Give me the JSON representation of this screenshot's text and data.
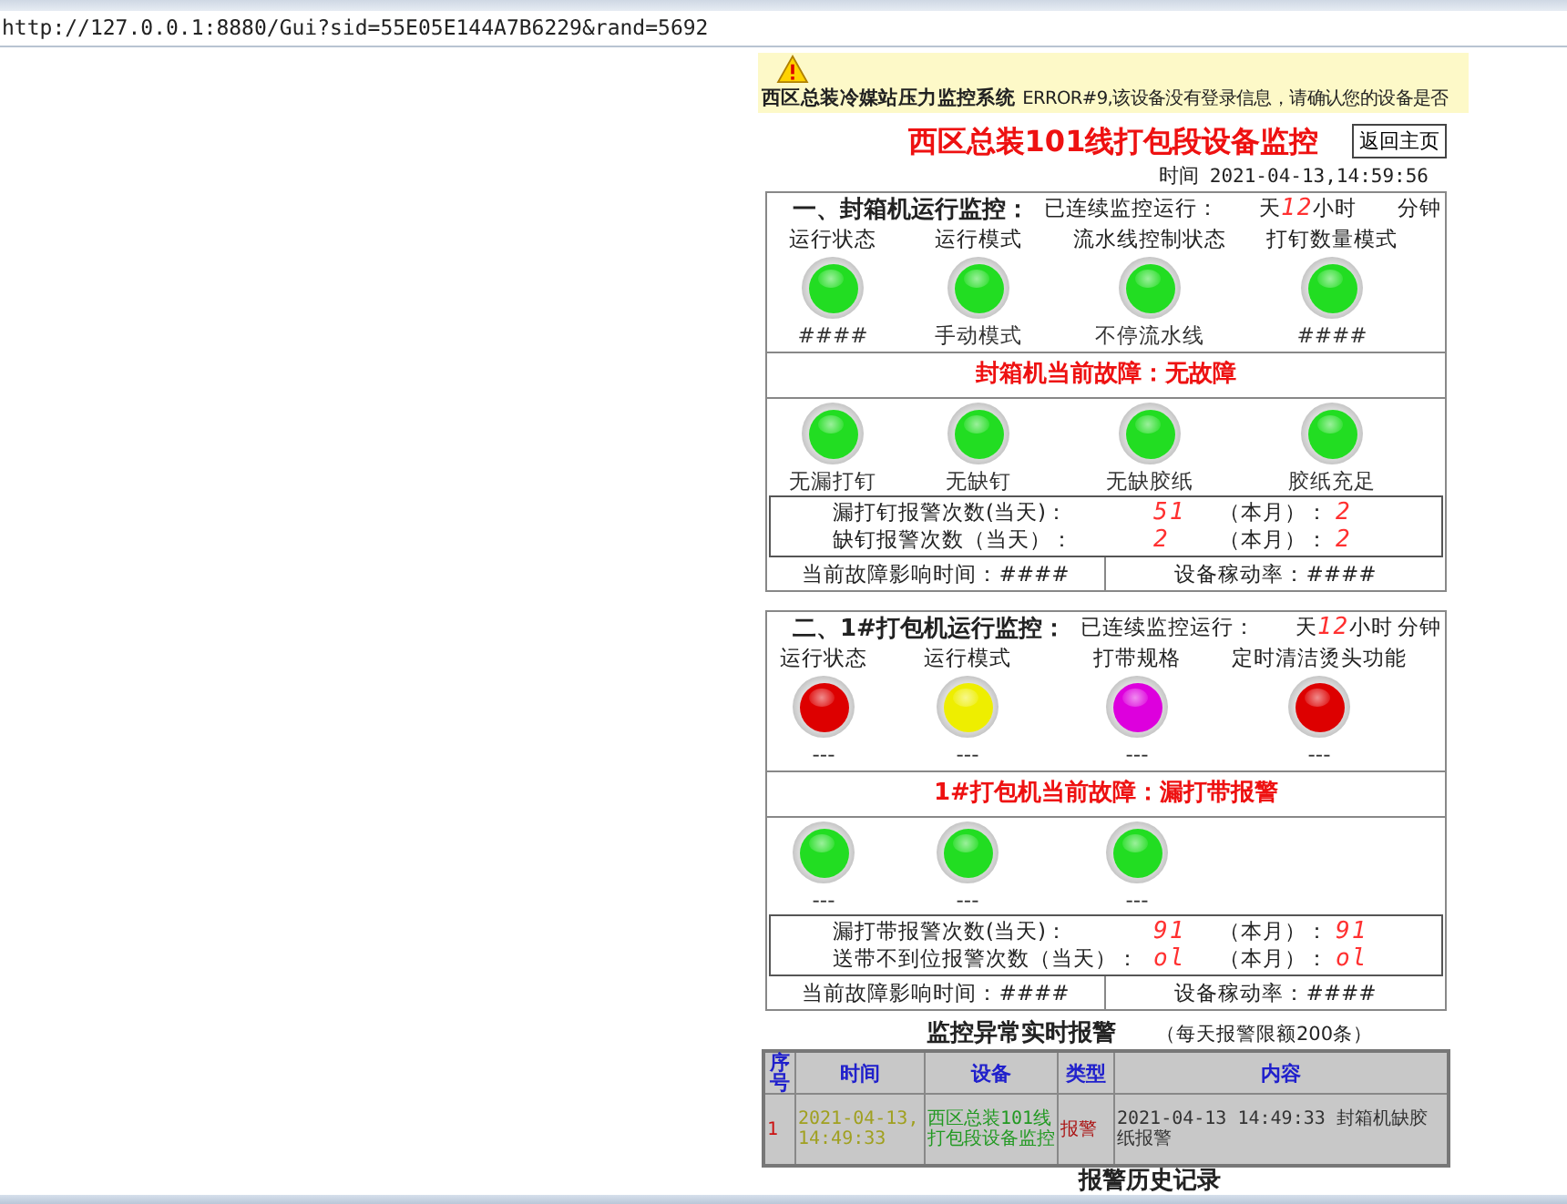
{
  "address_bar": {
    "url": "http://127.0.0.1:8880/Gui?sid=55E05E144A7B6229&rand=5692"
  },
  "notice": {
    "system": "西区总装冷媒站压力监控系统",
    "message": "ERROR#9,该设备没有登录信息，请确认您的设备是否"
  },
  "page_title": "西区总装101线打包段设备监控",
  "home_button": "返回主页",
  "time": {
    "label": "时间",
    "value": "2021-04-13,14:59:56"
  },
  "panels": [
    {
      "title": "一、封箱机运行监控：",
      "runtime": {
        "label": "已连续监控运行：",
        "days_unit": "天",
        "hours": "12",
        "hours_unit": "小时",
        "minutes_unit": "分钟"
      },
      "status_lamps": [
        {
          "label": "运行状态",
          "color": "#22dd22",
          "value": "####"
        },
        {
          "label": "运行模式",
          "color": "#22dd22",
          "value": "手动模式"
        },
        {
          "label": "流水线控制状态",
          "color": "#22dd22",
          "value": "不停流水线"
        },
        {
          "label": "打钉数量模式",
          "color": "#22dd22",
          "value": "####"
        }
      ],
      "fault": "封箱机当前故障：无故障",
      "fault_lamps": [
        {
          "color": "#22dd22",
          "value": "无漏打钉"
        },
        {
          "color": "#22dd22",
          "value": "无缺钉"
        },
        {
          "color": "#22dd22",
          "value": "无缺胶纸"
        },
        {
          "color": "#22dd22",
          "value": "胶纸充足"
        }
      ],
      "counters": [
        {
          "label": "漏打钉报警次数(当天)：",
          "today": "51",
          "month_label": "（本月）：",
          "month": "2"
        },
        {
          "label": "缺钉报警次数（当天）：",
          "today": "2",
          "month_label": "（本月）：",
          "month": "2"
        }
      ],
      "downtime": "当前故障影响时间：####",
      "utilization": "设备稼动率：####"
    },
    {
      "title": "二、1#打包机运行监控：",
      "runtime": {
        "label": "已连续监控运行：",
        "days_unit": "天",
        "hours": "12",
        "hours_unit": "小时",
        "minutes_unit": "分钟"
      },
      "status_lamps": [
        {
          "label": "运行状态",
          "color": "#dd0000",
          "value": "---"
        },
        {
          "label": "运行模式",
          "color": "#eeee00",
          "value": "---"
        },
        {
          "label": "打带规格",
          "color": "#dd00dd",
          "value": "---"
        },
        {
          "label": "定时清洁烫头功能",
          "color": "#dd0000",
          "value": "---"
        }
      ],
      "fault": "1#打包机当前故障：漏打带报警",
      "fault_lamps": [
        {
          "color": "#22dd22",
          "value": "---"
        },
        {
          "color": "#22dd22",
          "value": "---"
        },
        {
          "color": "#22dd22",
          "value": "---"
        }
      ],
      "counters": [
        {
          "label": "漏打带报警次数(当天)：",
          "today": "91",
          "month_label": "（本月）：",
          "month": "91"
        },
        {
          "label": "送带不到位报警次数（当天）：",
          "today": "ol",
          "month_label": "（本月）：",
          "month": "ol"
        }
      ],
      "downtime": "当前故障影响时间：####",
      "utilization": "设备稼动率：####"
    }
  ],
  "alarms": {
    "title": "监控异常实时报警",
    "note": "（每天报警限额200条）",
    "columns": [
      "序号",
      "时间",
      "设备",
      "类型",
      "内容"
    ],
    "rows": [
      [
        "1",
        "2021-04-13, 14:49:33",
        "西区总装101线打包段设备监控",
        "报警",
        "2021-04-13 14:49:33 封箱机缺胶纸报警"
      ]
    ]
  },
  "history_title": "报警历史记录"
}
